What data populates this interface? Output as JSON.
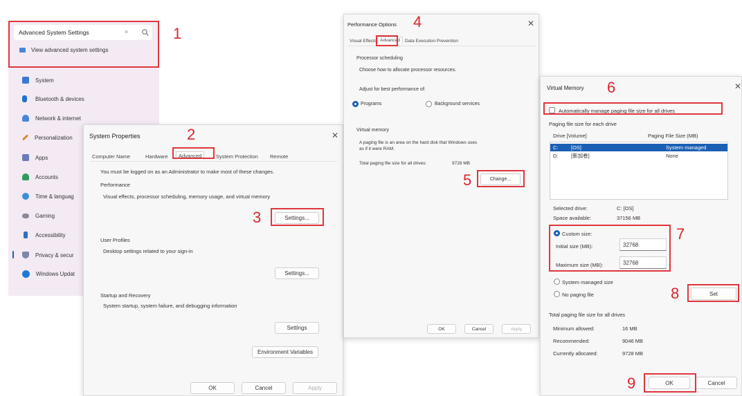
{
  "search": {
    "value": "Advanced System Settings",
    "suggestion": "View advanced system settings"
  },
  "sidebar": {
    "items": [
      {
        "label": "System",
        "icon": "monitor-icon",
        "color": "#3a78d6"
      },
      {
        "label": "Bluetooth & devices",
        "icon": "bluetooth-icon",
        "color": "#1f6fd1"
      },
      {
        "label": "Network & internet",
        "icon": "wifi-icon",
        "color": "#4a86d8"
      },
      {
        "label": "Personalization",
        "icon": "brush-icon",
        "color": "#d98a2b"
      },
      {
        "label": "Apps",
        "icon": "apps-icon",
        "color": "#6b7bb5"
      },
      {
        "label": "Accounts",
        "icon": "person-icon",
        "color": "#2f9d5a"
      },
      {
        "label": "Time & languag",
        "icon": "globe-icon",
        "color": "#3c8fd6"
      },
      {
        "label": "Gaming",
        "icon": "controller-icon",
        "color": "#8a8a9a"
      },
      {
        "label": "Accessibility",
        "icon": "accessibility-icon",
        "color": "#2e6fc0"
      },
      {
        "label": "Privacy & secur",
        "icon": "shield-icon",
        "color": "#7d88a8"
      },
      {
        "label": "Windows Updat",
        "icon": "update-icon",
        "color": "#1f7ad6"
      }
    ]
  },
  "system_properties": {
    "title": "System Properties",
    "tabs": [
      "Computer Name",
      "Hardware",
      "Advanced",
      "System Protection",
      "Remote"
    ],
    "admin_note": "You must be logged on as an Administrator to make most of these changes.",
    "performance": {
      "heading": "Performance",
      "desc": "Visual effects, processor scheduling, memory usage, and virtual memory",
      "button": "Settings..."
    },
    "user_profiles": {
      "heading": "User Profiles",
      "desc": "Desktop settings related to your sign-in",
      "button": "Settings..."
    },
    "startup": {
      "heading": "Startup and Recovery",
      "desc": "System startup, system failure, and debugging information",
      "button": "Settings"
    },
    "env_button": "Environment Variables",
    "ok": "OK",
    "cancel": "Cancel",
    "apply": "Apply"
  },
  "performance_options": {
    "title": "Performance Options",
    "tabs": [
      "Visual Effects",
      "Advanced",
      "Data Execution Prevention"
    ],
    "scheduling_heading": "Processor scheduling",
    "scheduling_desc": "Choose how to allocate processor resources.",
    "adjust_label": "Adjust for best performance of:",
    "programs": "Programs",
    "background": "Background services",
    "vm_heading": "Virtual memory",
    "vm_desc_1": "A paging file is an area on the hard disk that Windows uses",
    "vm_desc_2": "as if it were RAM.",
    "total_label": "Total paging file size for all drives:",
    "total_value": "9728 MB",
    "change_button": "Change...",
    "ok": "OK",
    "cancel": "Cancel",
    "apply": "Apply"
  },
  "virtual_memory": {
    "title": "Virtual Memory",
    "auto_manage": "Automatically manage paging file size for all drives",
    "per_drive": "Paging file size for each drive",
    "col_drive": "Drive  [Volume]",
    "col_size": "Paging File Size (MB)",
    "drives": [
      {
        "drive": "C:",
        "volume": "[OS]",
        "size": "System managed"
      },
      {
        "drive": "D:",
        "volume": "[新加卷]",
        "size": "None"
      }
    ],
    "selected_drive_label": "Selected drive:",
    "selected_drive_value": "C:  [OS]",
    "space_label": "Space available:",
    "space_value": "37156 MB",
    "custom_size": "Custom size:",
    "initial_label": "Initial size (MB):",
    "initial_value": "32768",
    "maximum_label": "Maximum size (MB):",
    "maximum_value": "32768",
    "system_managed": "System managed size",
    "no_paging": "No paging file",
    "set_button": "Set",
    "totals_heading": "Total paging file size for all drives",
    "min_label": "Minimum allowed:",
    "min_value": "16 MB",
    "rec_label": "Recommended:",
    "rec_value": "9046 MB",
    "alloc_label": "Currently allocated:",
    "alloc_value": "9728 MB",
    "ok": "OK",
    "cancel": "Cancel"
  },
  "steps": [
    "1",
    "2",
    "3",
    "4",
    "5",
    "6",
    "7",
    "8",
    "9"
  ],
  "colors": {
    "highlight": "#e0353b",
    "step_number": "#d9252b",
    "selection": "#1a5fb4",
    "settings_bg": "#f3eaf4"
  }
}
